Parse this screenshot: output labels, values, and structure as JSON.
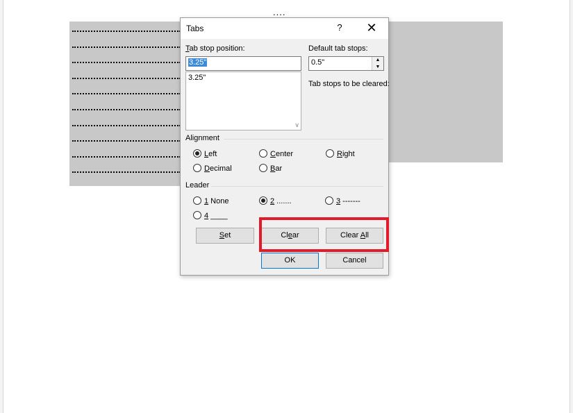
{
  "document": {
    "top_leader": "....",
    "leader_rows": 10
  },
  "dialog": {
    "title": "Tabs",
    "help_label": "?",
    "close_label": "✕",
    "tab_stop_position_label": {
      "accel": "T",
      "rest": "ab stop position:"
    },
    "tab_stop_position_value": "3.25\"",
    "tab_stop_list": [
      "3.25\""
    ],
    "default_tab_stops_label": "Default tab stops:",
    "default_tab_stops_value": "0.5\"",
    "tab_stops_cleared_label": "Tab stops to be cleared:",
    "alignment": {
      "label": "Alignment",
      "options": [
        {
          "accel": "L",
          "rest": "eft",
          "checked": true
        },
        {
          "accel": "C",
          "rest": "enter",
          "checked": false
        },
        {
          "accel": "R",
          "rest": "ight",
          "checked": false
        },
        {
          "accel": "D",
          "rest": "ecimal",
          "checked": false
        },
        {
          "accel": "B",
          "rest": "ar",
          "checked": false
        }
      ]
    },
    "leader": {
      "label": "Leader",
      "options": [
        {
          "accel": "1",
          "rest": " None",
          "checked": false
        },
        {
          "accel": "2",
          "rest": " .......",
          "checked": true
        },
        {
          "accel": "3",
          "rest": " -------",
          "checked": false
        },
        {
          "accel": "4",
          "rest": " ____",
          "checked": false
        }
      ]
    },
    "buttons": {
      "set": {
        "accel": "S",
        "rest": "et"
      },
      "clear": {
        "pre": "Cl",
        "accel": "e",
        "rest": "ar"
      },
      "clear_all": {
        "pre": "Clear ",
        "accel": "A",
        "rest": "ll"
      },
      "ok": "OK",
      "cancel": "Cancel"
    }
  },
  "colors": {
    "highlight": "#e21a2a",
    "selection": "#3c8ad8"
  }
}
